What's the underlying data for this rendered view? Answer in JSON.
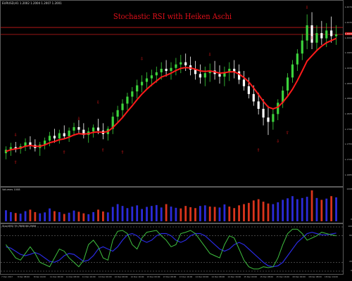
{
  "header": {
    "symbol_info": "EURUSD,H1  1.2002 1.2004 1.2007 1.2001",
    "title": "Stochastic RSI with Heiken Aschi"
  },
  "colors": {
    "bull_candle": "#3cd33c",
    "bear_candle": "#ffffff",
    "ma_line": "#ff1a1a",
    "volume_blue": "#2b2bd9",
    "volume_red": "#d9341c",
    "stoch_k": "#3fbf3f",
    "stoch_d": "#2a2ae0",
    "hline": "#cc1a1a"
  },
  "price_axis": {
    "ticks": [
      "1.2070",
      "1.2035",
      "1.2000",
      "1.1965",
      "1.1930",
      "1.1895",
      "1.1860",
      "1.1825",
      "1.1790",
      "1.1755",
      "1.1720",
      "1.1685"
    ],
    "current_price": "1.2009"
  },
  "volume_pane": {
    "label": "Volumes 1008",
    "axis_top": "1008",
    "axis_bottom": "0"
  },
  "stoch_pane": {
    "label": "StochRSI 79.7868 86.2986",
    "levels": [
      "100",
      "80",
      "20",
      "0"
    ]
  },
  "time_axis": {
    "labels": [
      "7 Dec 2017",
      "8 Dec 08:00",
      "8 Dec 16:00",
      "11 Dec 00:00",
      "11 Dec 08:00",
      "11 Dec 16:00",
      "12 Dec 00:00",
      "12 Dec 08:00",
      "12 Dec 16:00",
      "13 Dec 00:00",
      "13 Dec 08:00",
      "13 Dec 16:00",
      "14 Dec 00:00",
      "14 Dec 08:00",
      "14 Dec 16:00",
      "15 Dec 00:00",
      "15 Dec 08:00",
      "15 Dec 16:00",
      "18 Dec 00:00",
      "18 Dec 08:00",
      "18 Dec 16:00"
    ]
  },
  "chart_data": {
    "type": "line",
    "candles": [
      {
        "o": 1.1736,
        "h": 1.1752,
        "l": 1.1722,
        "c": 1.1744
      },
      {
        "o": 1.1744,
        "h": 1.176,
        "l": 1.173,
        "c": 1.175
      },
      {
        "o": 1.175,
        "h": 1.1762,
        "l": 1.1738,
        "c": 1.1746
      },
      {
        "o": 1.1746,
        "h": 1.1758,
        "l": 1.1735,
        "c": 1.1752
      },
      {
        "o": 1.1752,
        "h": 1.177,
        "l": 1.1741,
        "c": 1.1761
      },
      {
        "o": 1.1761,
        "h": 1.1775,
        "l": 1.1745,
        "c": 1.1755
      },
      {
        "o": 1.1755,
        "h": 1.1768,
        "l": 1.174,
        "c": 1.1748
      },
      {
        "o": 1.1748,
        "h": 1.1762,
        "l": 1.173,
        "c": 1.1756
      },
      {
        "o": 1.1756,
        "h": 1.1772,
        "l": 1.1745,
        "c": 1.1765
      },
      {
        "o": 1.1765,
        "h": 1.1785,
        "l": 1.1752,
        "c": 1.1776
      },
      {
        "o": 1.1776,
        "h": 1.1792,
        "l": 1.176,
        "c": 1.177
      },
      {
        "o": 1.177,
        "h": 1.179,
        "l": 1.1758,
        "c": 1.1782
      },
      {
        "o": 1.1782,
        "h": 1.18,
        "l": 1.177,
        "c": 1.1775
      },
      {
        "o": 1.1775,
        "h": 1.1795,
        "l": 1.1762,
        "c": 1.1788
      },
      {
        "o": 1.1788,
        "h": 1.1806,
        "l": 1.1776,
        "c": 1.1796
      },
      {
        "o": 1.1796,
        "h": 1.1812,
        "l": 1.1782,
        "c": 1.179
      },
      {
        "o": 1.179,
        "h": 1.1805,
        "l": 1.177,
        "c": 1.1778
      },
      {
        "o": 1.1778,
        "h": 1.1795,
        "l": 1.176,
        "c": 1.1786
      },
      {
        "o": 1.1786,
        "h": 1.1802,
        "l": 1.1772,
        "c": 1.1795
      },
      {
        "o": 1.1795,
        "h": 1.1815,
        "l": 1.178,
        "c": 1.1788
      },
      {
        "o": 1.1788,
        "h": 1.1805,
        "l": 1.1768,
        "c": 1.178
      },
      {
        "o": 1.178,
        "h": 1.1798,
        "l": 1.1765,
        "c": 1.1792
      },
      {
        "o": 1.1792,
        "h": 1.183,
        "l": 1.178,
        "c": 1.182
      },
      {
        "o": 1.182,
        "h": 1.1845,
        "l": 1.1805,
        "c": 1.1835
      },
      {
        "o": 1.1835,
        "h": 1.186,
        "l": 1.182,
        "c": 1.185
      },
      {
        "o": 1.185,
        "h": 1.1875,
        "l": 1.1835,
        "c": 1.1866
      },
      {
        "o": 1.1866,
        "h": 1.1888,
        "l": 1.185,
        "c": 1.1878
      },
      {
        "o": 1.1878,
        "h": 1.1905,
        "l": 1.1862,
        "c": 1.1892
      },
      {
        "o": 1.1892,
        "h": 1.1915,
        "l": 1.1876,
        "c": 1.19
      },
      {
        "o": 1.19,
        "h": 1.1922,
        "l": 1.1884,
        "c": 1.1908
      },
      {
        "o": 1.1908,
        "h": 1.1928,
        "l": 1.189,
        "c": 1.1915
      },
      {
        "o": 1.1915,
        "h": 1.1935,
        "l": 1.1898,
        "c": 1.1922
      },
      {
        "o": 1.1922,
        "h": 1.1945,
        "l": 1.1905,
        "c": 1.193
      },
      {
        "o": 1.193,
        "h": 1.195,
        "l": 1.1912,
        "c": 1.1925
      },
      {
        "o": 1.1925,
        "h": 1.1945,
        "l": 1.1905,
        "c": 1.1932
      },
      {
        "o": 1.1932,
        "h": 1.1955,
        "l": 1.1915,
        "c": 1.194
      },
      {
        "o": 1.194,
        "h": 1.1962,
        "l": 1.192,
        "c": 1.1945
      },
      {
        "o": 1.1945,
        "h": 1.1965,
        "l": 1.1925,
        "c": 1.1938
      },
      {
        "o": 1.1938,
        "h": 1.1958,
        "l": 1.1915,
        "c": 1.1928
      },
      {
        "o": 1.1928,
        "h": 1.1948,
        "l": 1.1905,
        "c": 1.1918
      },
      {
        "o": 1.1918,
        "h": 1.194,
        "l": 1.1896,
        "c": 1.191
      },
      {
        "o": 1.191,
        "h": 1.1935,
        "l": 1.189,
        "c": 1.192
      },
      {
        "o": 1.192,
        "h": 1.1942,
        "l": 1.19,
        "c": 1.1926
      },
      {
        "o": 1.1926,
        "h": 1.1948,
        "l": 1.1905,
        "c": 1.1918
      },
      {
        "o": 1.1918,
        "h": 1.1938,
        "l": 1.1896,
        "c": 1.1912
      },
      {
        "o": 1.1912,
        "h": 1.1935,
        "l": 1.189,
        "c": 1.1922
      },
      {
        "o": 1.1922,
        "h": 1.1945,
        "l": 1.1902,
        "c": 1.193
      },
      {
        "o": 1.193,
        "h": 1.195,
        "l": 1.1908,
        "c": 1.1924
      },
      {
        "o": 1.1924,
        "h": 1.194,
        "l": 1.1895,
        "c": 1.1905
      },
      {
        "o": 1.1905,
        "h": 1.1925,
        "l": 1.188,
        "c": 1.189
      },
      {
        "o": 1.189,
        "h": 1.191,
        "l": 1.1862,
        "c": 1.1872
      },
      {
        "o": 1.1872,
        "h": 1.1892,
        "l": 1.1845,
        "c": 1.1855
      },
      {
        "o": 1.1855,
        "h": 1.1875,
        "l": 1.1825,
        "c": 1.1838
      },
      {
        "o": 1.1838,
        "h": 1.186,
        "l": 1.18,
        "c": 1.1818
      },
      {
        "o": 1.1818,
        "h": 1.1845,
        "l": 1.1778,
        "c": 1.1808
      },
      {
        "o": 1.1808,
        "h": 1.1838,
        "l": 1.179,
        "c": 1.1826
      },
      {
        "o": 1.1826,
        "h": 1.186,
        "l": 1.1812,
        "c": 1.1852
      },
      {
        "o": 1.1852,
        "h": 1.189,
        "l": 1.184,
        "c": 1.188
      },
      {
        "o": 1.188,
        "h": 1.192,
        "l": 1.1868,
        "c": 1.191
      },
      {
        "o": 1.191,
        "h": 1.195,
        "l": 1.1898,
        "c": 1.194
      },
      {
        "o": 1.194,
        "h": 1.1975,
        "l": 1.1925,
        "c": 1.1965
      },
      {
        "o": 1.1965,
        "h": 1.201,
        "l": 1.195,
        "c": 1.1995
      },
      {
        "o": 1.1995,
        "h": 1.2055,
        "l": 1.1975,
        "c": 1.203
      },
      {
        "o": 1.203,
        "h": 1.206,
        "l": 1.1975,
        "c": 1.199
      },
      {
        "o": 1.199,
        "h": 1.203,
        "l": 1.197,
        "c": 1.2012
      },
      {
        "o": 1.2012,
        "h": 1.204,
        "l": 1.1985,
        "c": 1.2
      },
      {
        "o": 1.2,
        "h": 1.2035,
        "l": 1.198,
        "c": 1.2018
      },
      {
        "o": 1.2018,
        "h": 1.205,
        "l": 1.199,
        "c": 1.2005
      },
      {
        "o": 1.2005,
        "h": 1.203,
        "l": 1.1985,
        "c": 1.2009
      }
    ],
    "ma": [
      1.174,
      1.1744,
      1.1746,
      1.1748,
      1.1752,
      1.1754,
      1.1752,
      1.1752,
      1.1755,
      1.176,
      1.1763,
      1.1767,
      1.1769,
      1.1773,
      1.1778,
      1.1781,
      1.178,
      1.1781,
      1.1784,
      1.1785,
      1.1784,
      1.1786,
      1.1795,
      1.1806,
      1.1818,
      1.1832,
      1.1845,
      1.1859,
      1.1872,
      1.1883,
      1.1893,
      1.1902,
      1.1911,
      1.1915,
      1.192,
      1.1926,
      1.1931,
      1.1933,
      1.1932,
      1.1929,
      1.1925,
      1.1924,
      1.1925,
      1.1923,
      1.192,
      1.1921,
      1.1923,
      1.1923,
      1.1918,
      1.191,
      1.19,
      1.1886,
      1.1871,
      1.1855,
      1.1842,
      1.1838,
      1.1842,
      1.1853,
      1.1867,
      1.1883,
      1.1903,
      1.1925,
      1.1948,
      1.196,
      1.1972,
      1.1982,
      1.199,
      1.1995,
      1.2
    ],
    "hlines": [
      1.2025,
      1.2009
    ],
    "ylim": [
      1.167,
      1.208
    ],
    "volume": {
      "values": [
        360,
        300,
        270,
        250,
        330,
        380,
        300,
        260,
        290,
        420,
        330,
        300,
        240,
        280,
        350,
        310,
        260,
        230,
        300,
        380,
        320,
        290,
        470,
        560,
        500,
        430,
        480,
        520,
        400,
        470,
        500,
        530,
        450,
        560,
        480,
        440,
        420,
        500,
        460,
        430,
        500,
        520,
        480,
        470,
        450,
        550,
        480,
        430,
        520,
        560,
        600,
        680,
        720,
        640,
        580,
        560,
        620,
        700,
        750,
        820,
        720,
        760,
        800,
        1008,
        760,
        700,
        740,
        820,
        780
      ],
      "colors": [
        "blue",
        "blue",
        "red",
        "blue",
        "blue",
        "red",
        "red",
        "blue",
        "blue",
        "blue",
        "red",
        "blue",
        "red",
        "blue",
        "blue",
        "red",
        "red",
        "blue",
        "blue",
        "red",
        "red",
        "blue",
        "blue",
        "blue",
        "blue",
        "blue",
        "blue",
        "blue",
        "blue",
        "blue",
        "blue",
        "blue",
        "blue",
        "red",
        "blue",
        "blue",
        "red",
        "red",
        "red",
        "red",
        "blue",
        "blue",
        "red",
        "red",
        "blue",
        "blue",
        "red",
        "red",
        "red",
        "red",
        "red",
        "red",
        "red",
        "red",
        "red",
        "blue",
        "blue",
        "blue",
        "blue",
        "blue",
        "blue",
        "blue",
        "blue",
        "red",
        "blue",
        "red",
        "blue",
        "red",
        "blue"
      ],
      "ylim": [
        0,
        1008
      ]
    },
    "stochrsi": {
      "k": [
        60,
        45,
        30,
        25,
        40,
        55,
        40,
        20,
        15,
        10,
        30,
        50,
        45,
        30,
        20,
        10,
        25,
        60,
        70,
        55,
        30,
        25,
        70,
        90,
        92,
        85,
        60,
        50,
        75,
        88,
        90,
        92,
        80,
        70,
        55,
        60,
        85,
        88,
        92,
        85,
        70,
        55,
        40,
        35,
        30,
        60,
        80,
        75,
        50,
        25,
        10,
        5,
        5,
        10,
        8,
        10,
        30,
        60,
        85,
        95,
        95,
        85,
        70,
        75,
        80,
        88,
        85,
        82,
        80
      ],
      "d": [
        55,
        52,
        45,
        38,
        35,
        38,
        42,
        38,
        30,
        22,
        20,
        25,
        35,
        40,
        38,
        30,
        22,
        25,
        35,
        50,
        55,
        50,
        45,
        55,
        70,
        82,
        85,
        80,
        70,
        65,
        70,
        80,
        85,
        85,
        80,
        70,
        65,
        70,
        80,
        85,
        85,
        80,
        70,
        60,
        50,
        45,
        50,
        60,
        65,
        60,
        50,
        40,
        30,
        20,
        12,
        10,
        12,
        20,
        35,
        50,
        65,
        75,
        85,
        88,
        85,
        82,
        82,
        84,
        86
      ],
      "levels": [
        100,
        80,
        20,
        0
      ]
    },
    "arrow_marks": [
      {
        "i": 2,
        "dir": "down",
        "v": 1.1775
      },
      {
        "i": 2,
        "dir": "up",
        "v": 1.1712
      },
      {
        "i": 12,
        "dir": "up",
        "v": 1.1735
      },
      {
        "i": 15,
        "dir": "down",
        "v": 1.1812
      },
      {
        "i": 19,
        "dir": "down",
        "v": 1.185
      },
      {
        "i": 20,
        "dir": "up",
        "v": 1.174
      },
      {
        "i": 24,
        "dir": "up",
        "v": 1.1735
      },
      {
        "i": 28,
        "dir": "down",
        "v": 1.195
      },
      {
        "i": 42,
        "dir": "down",
        "v": 1.196
      },
      {
        "i": 50,
        "dir": "down",
        "v": 1.1892
      },
      {
        "i": 52,
        "dir": "up",
        "v": 1.174
      },
      {
        "i": 56,
        "dir": "down",
        "v": 1.176
      },
      {
        "i": 58,
        "dir": "up",
        "v": 1.178
      },
      {
        "i": 62,
        "dir": "down",
        "v": 1.2068
      },
      {
        "i": 63,
        "dir": "up",
        "v": 1.1998
      }
    ]
  }
}
